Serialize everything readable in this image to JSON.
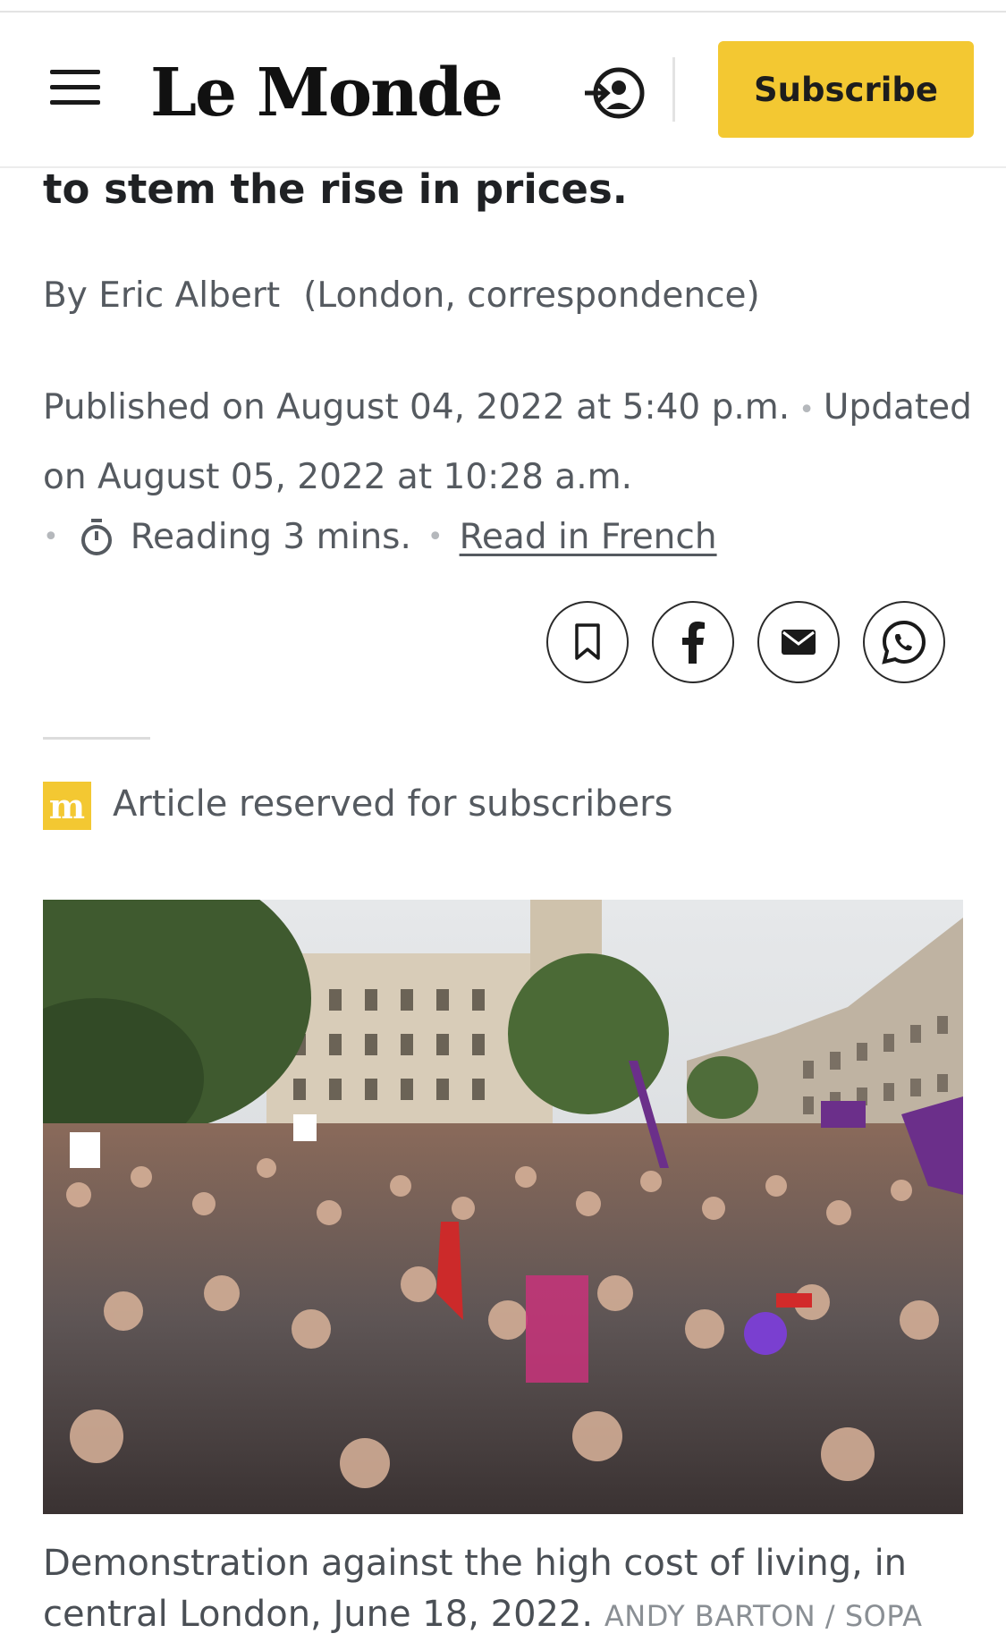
{
  "header": {
    "logo": "Le Monde",
    "subscribe_label": "Subscribe"
  },
  "article": {
    "headline_tail": "to stem the rise in prices.",
    "byline_author": "By Eric Albert",
    "byline_role": "(London, correspondence)",
    "published": "Published on August 04, 2022 at 5:40 p.m.",
    "updated": "Updated on August 05, 2022 at 10:28 a.m.",
    "reading_time": "Reading 3 mins.",
    "read_in_french": "Read in French",
    "reserved_badge_letter": "m",
    "reserved_notice": "Article reserved for subscribers",
    "caption": "Demonstration against the high cost of living, in central London, June 18, 2022.",
    "photo_credit": "ANDY BARTON / SOPA"
  },
  "share": {
    "icons": [
      "bookmark-icon",
      "facebook-icon",
      "email-icon",
      "whatsapp-icon"
    ]
  },
  "colors": {
    "accent": "#f3c832",
    "text": "#1f2124",
    "muted": "#555a60"
  }
}
